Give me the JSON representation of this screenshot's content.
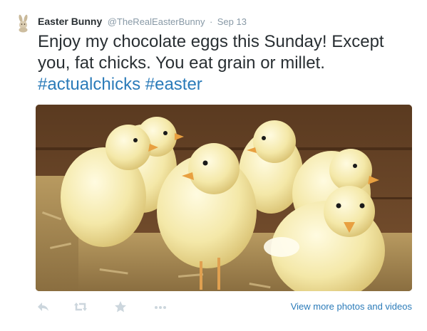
{
  "tweet": {
    "author_name": "Easter Bunny",
    "handle": "@TheRealEasterBunny",
    "separator": "·",
    "timestamp": "Sep 13",
    "text_plain": "Enjoy my chocolate eggs this Sunday! Except you, fat chicks. You eat grain or millet. ",
    "hashtags": [
      "#actualchicks",
      "#easter"
    ],
    "media_alt": "photo-of-yellow-chicks",
    "view_more_label": "View more photos and videos"
  },
  "actions": [
    {
      "name": "reply-icon"
    },
    {
      "name": "retweet-icon"
    },
    {
      "name": "favorite-icon"
    },
    {
      "name": "more-icon"
    }
  ],
  "colors": {
    "link": "#2b7bb9",
    "muted": "#8899a6",
    "text": "#292f33",
    "icon": "#ccd6dd"
  }
}
